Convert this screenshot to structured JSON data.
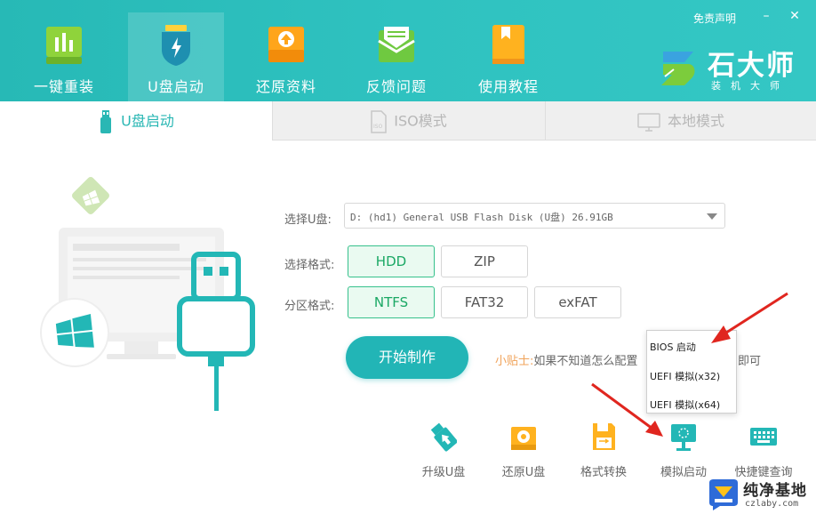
{
  "nav": [
    {
      "label": "一键重装",
      "icon": "chart-bars-icon"
    },
    {
      "label": "U盘启动",
      "icon": "usb-shield-icon"
    },
    {
      "label": "还原资料",
      "icon": "restore-folder-icon"
    },
    {
      "label": "反馈问题",
      "icon": "envelope-icon"
    },
    {
      "label": "使用教程",
      "icon": "book-icon"
    }
  ],
  "header": {
    "disclaimer": "免责声明",
    "minimize": "–",
    "close": "✕",
    "brand_name": "石大师",
    "brand_sub": "装机大师"
  },
  "tabs": [
    {
      "label": "U盘启动",
      "icon": "usb-drive-icon"
    },
    {
      "label": "ISO模式",
      "icon": "iso-file-icon"
    },
    {
      "label": "本地模式",
      "icon": "monitor-icon"
    }
  ],
  "form": {
    "usb_label": "选择U盘:",
    "usb_value": "D: (hd1) General USB Flash Disk  (U盘) 26.91GB",
    "format_label": "选择格式:",
    "format_options": [
      "HDD",
      "ZIP"
    ],
    "partition_label": "分区格式:",
    "partition_options": [
      "NTFS",
      "FAT32",
      "exFAT"
    ],
    "start_button": "开始制作",
    "tip_label": "小贴士:",
    "tip_text": "如果不知道怎么配置",
    "tip_end": "即可"
  },
  "menu": [
    "BIOS 启动",
    "UEFI 模拟(x32)",
    "UEFI 模拟(x64)"
  ],
  "tools": [
    {
      "label": "升级U盘",
      "icon": "usb-upgrade-icon"
    },
    {
      "label": "还原U盘",
      "icon": "restore-disk-icon"
    },
    {
      "label": "格式转换",
      "icon": "floppy-convert-icon"
    },
    {
      "label": "模拟启动",
      "icon": "simulate-boot-icon"
    },
    {
      "label": "快捷键查询",
      "icon": "keyboard-icon"
    }
  ],
  "watermark": {
    "name": "纯净基地",
    "url": "czlaby.com"
  },
  "colors": {
    "accent": "#27b9b6",
    "selected_green": "#1ba865",
    "arrow_red": "#e0261f"
  }
}
